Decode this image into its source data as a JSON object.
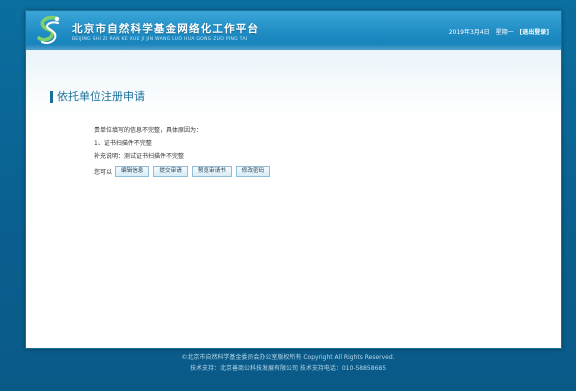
{
  "header": {
    "site_title": "北京市自然科学基金网络化工作平台",
    "site_subtitle": "BEIJING SHI ZI RAN KE XUE JI JIN WANG LUO HUA GONG ZUO PING TAI",
    "date": "2019年3月4日",
    "weekday": "星期一",
    "logout_label": "[退出登录]"
  },
  "page": {
    "title": "依托单位注册申请"
  },
  "message": {
    "line1": "贵单位填写的信息不完整，具体原因为：",
    "line2": "1、证书扫描件不完整",
    "line3": "补充说明：测试证书扫描件不完整",
    "lead": "您可以"
  },
  "buttons": {
    "edit": "编辑信息",
    "submit": "提交审请",
    "preview": "预览审请书",
    "change_password": "修改密码"
  },
  "footer": {
    "copyright": "©北京市自然科学基金委员会办公室版权所有 Copyright All Rights Reserved.",
    "support": "技术支持：北京善商公科技发展有限公司  技术支持电话：010-58858685"
  },
  "colors": {
    "background": "#0b6fa0",
    "header": "#1f8cc4",
    "accent": "#1a6f9a"
  }
}
